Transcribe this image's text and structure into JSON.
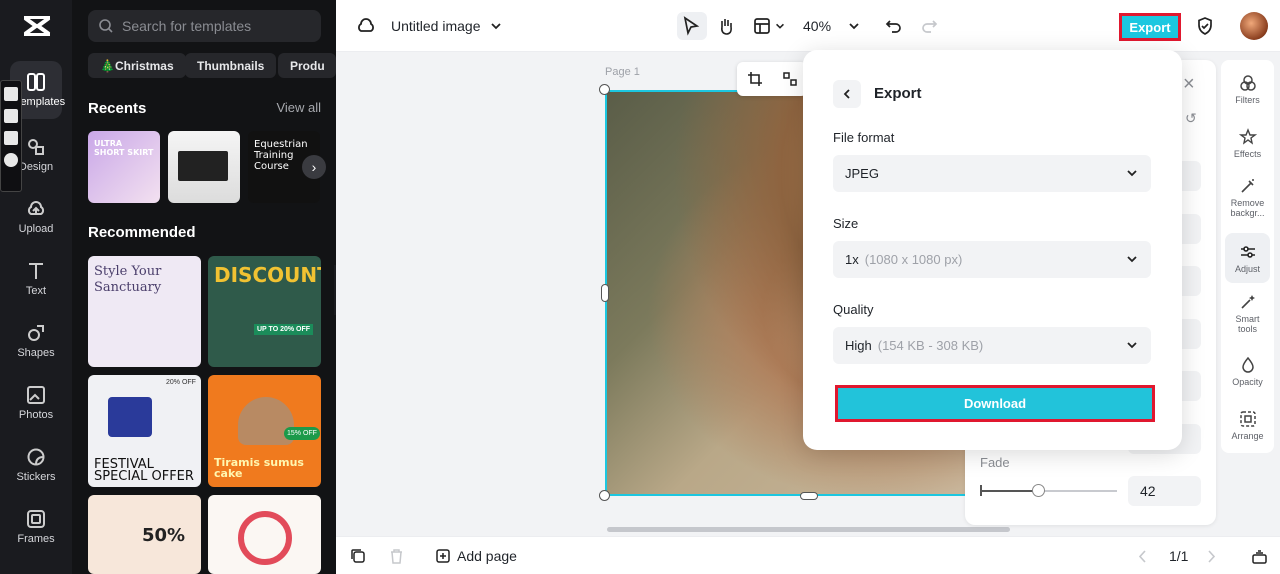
{
  "rail": {
    "items": [
      {
        "label": "Templates",
        "icon": "templates-icon"
      },
      {
        "label": "Design",
        "icon": "design-icon"
      },
      {
        "label": "Upload",
        "icon": "upload-icon"
      },
      {
        "label": "Text",
        "icon": "text-icon"
      },
      {
        "label": "Shapes",
        "icon": "shapes-icon"
      },
      {
        "label": "Photos",
        "icon": "photos-icon"
      },
      {
        "label": "Stickers",
        "icon": "stickers-icon"
      },
      {
        "label": "Frames",
        "icon": "frames-icon"
      }
    ]
  },
  "panel": {
    "search_placeholder": "Search for templates",
    "chips": [
      "🎄Christmas",
      "Thumbnails",
      "Produ"
    ],
    "recents_title": "Recents",
    "view_all": "View all",
    "recommended_title": "Recommended",
    "recents": [
      {
        "text": "ULTRA SHORT SKIRT"
      },
      {
        "text": ""
      },
      {
        "text": "Equestrian Training Course"
      }
    ],
    "recommended": [
      {
        "text": "Style Your Sanctuary"
      },
      {
        "text": "DISCOUNT",
        "sub": "UP TO 20% OFF"
      },
      {
        "text": "FESTIVAL SPECIAL OFFER",
        "sub": "20% OFF"
      },
      {
        "text": "Tiramis sumus cake",
        "sub": "15% OFF"
      },
      {
        "text": "50%"
      },
      {
        "text": ""
      }
    ]
  },
  "topbar": {
    "doc_title": "Untitled image",
    "zoom": "40%",
    "export_label": "Export"
  },
  "canvas": {
    "page_label": "Page 1"
  },
  "export_popup": {
    "title": "Export",
    "file_format_label": "File format",
    "file_format_value": "JPEG",
    "size_label": "Size",
    "size_value": "1x",
    "size_detail": "(1080 x 1080 px)",
    "quality_label": "Quality",
    "quality_value": "High",
    "quality_detail": "(154 KB - 308 KB)",
    "download_label": "Download"
  },
  "properties": {
    "fade_label": "Fade",
    "fade_value": "42",
    "fade_fraction": 0.42
  },
  "tools": [
    {
      "label": "Filters",
      "icon": "filters-icon"
    },
    {
      "label": "Effects",
      "icon": "effects-icon"
    },
    {
      "label": "Remove backgr...",
      "icon": "remove-background-icon"
    },
    {
      "label": "Adjust",
      "icon": "adjust-icon"
    },
    {
      "label": "Smart tools",
      "icon": "smart-tools-icon"
    },
    {
      "label": "Opacity",
      "icon": "opacity-icon"
    },
    {
      "label": "Arrange",
      "icon": "arrange-icon"
    }
  ],
  "bottombar": {
    "add_page": "Add page",
    "page_counter": "1/1"
  },
  "colors": {
    "accent": "#1cc7e0",
    "highlight": "#e0182f",
    "rail_bg": "#1a1b1f"
  }
}
